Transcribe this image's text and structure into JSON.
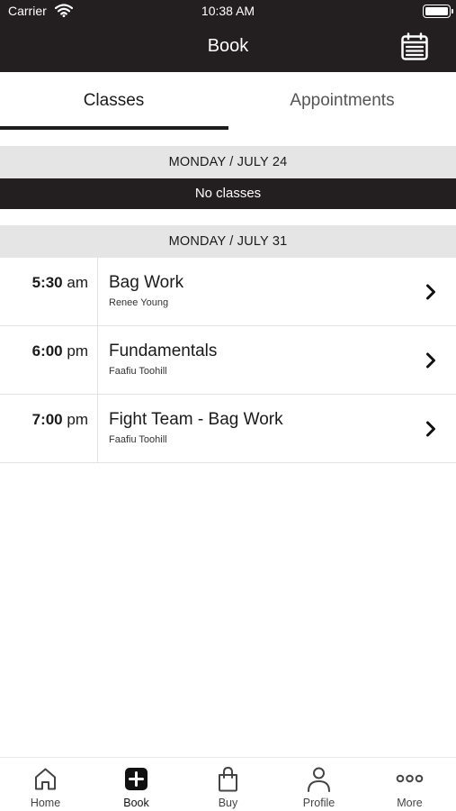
{
  "status_bar": {
    "carrier": "Carrier",
    "time": "10:38 AM",
    "wifi_icon": "wifi-icon",
    "battery_icon": "battery-icon"
  },
  "header": {
    "title": "Book",
    "calendar_icon": "calendar-icon"
  },
  "tabs": [
    {
      "label": "Classes",
      "active": true
    },
    {
      "label": "Appointments",
      "active": false
    }
  ],
  "days": [
    {
      "header": "MONDAY / JULY 24",
      "empty_message": "No classes",
      "classes": []
    },
    {
      "header": "MONDAY / JULY 31",
      "classes": [
        {
          "time": "5:30",
          "period": "am",
          "name": "Bag Work",
          "instructor": "Renee Young"
        },
        {
          "time": "6:00",
          "period": "pm",
          "name": "Fundamentals",
          "instructor": "Faafiu Toohill"
        },
        {
          "time": "7:00",
          "period": "pm",
          "name": "Fight Team - Bag Work",
          "instructor": "Faafiu Toohill"
        }
      ]
    }
  ],
  "tab_bar": {
    "items": [
      {
        "label": "Home",
        "icon": "home-icon",
        "active": false
      },
      {
        "label": "Book",
        "icon": "plus-square-icon",
        "active": true
      },
      {
        "label": "Buy",
        "icon": "shopping-bag-icon",
        "active": false
      },
      {
        "label": "Profile",
        "icon": "person-icon",
        "active": false
      },
      {
        "label": "More",
        "icon": "more-dots-icon",
        "active": false
      }
    ]
  },
  "colors": {
    "header_bg": "#231f20",
    "day_header_bg": "#e5e5e5",
    "accent": "#1d1d1d"
  }
}
